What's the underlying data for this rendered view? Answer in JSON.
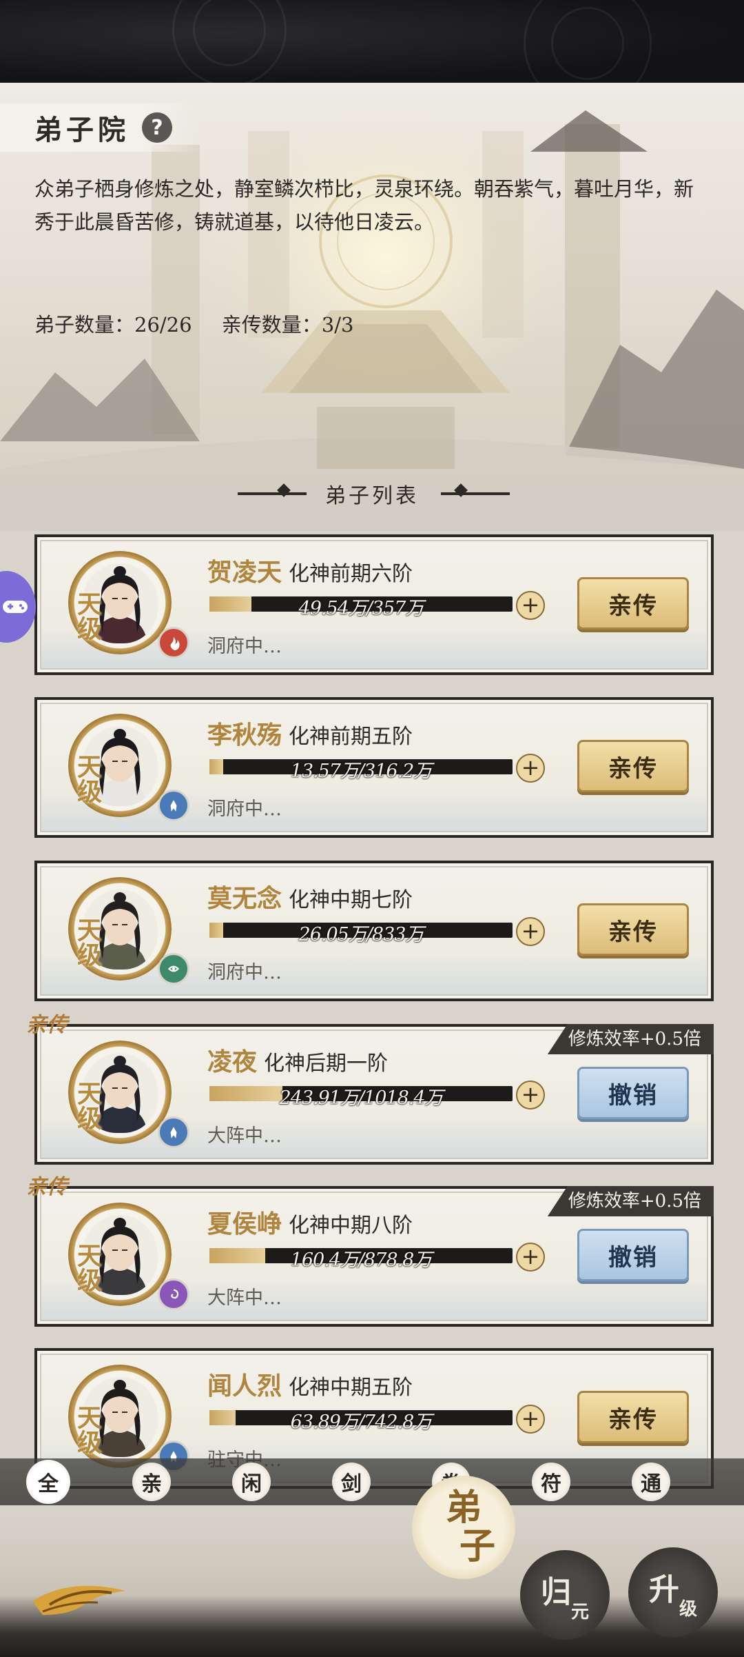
{
  "page": {
    "title": "弟子院",
    "intro": "众弟子栖身修炼之处，静室鳞次栉比，灵泉环绕。朝吞紫气，暮吐月华，新秀于此晨昏苦修，铸就道基，以待他日凌云。",
    "disciple_count": "弟子数量：26/26",
    "apprentice_count": "亲传数量：3/3",
    "list_title": "弟子列表"
  },
  "disciples": [
    {
      "name": "贺凌天",
      "realm": "化神前期六阶",
      "exp": "49.54万/357万",
      "progress": 0.139,
      "status": "洞府中…",
      "rank": "天级",
      "element_icon": "fire-icon",
      "element_color": "#c9483a",
      "action": "亲传",
      "action_style": "gold",
      "is_apprentice": false,
      "bonus": "",
      "hair": "#1c1a1d",
      "robe": "#4a2a30"
    },
    {
      "name": "李秋殇",
      "realm": "化神前期五阶",
      "exp": "13.57万/316.2万",
      "progress": 0.043,
      "status": "洞府中…",
      "rank": "天级",
      "element_icon": "water-icon",
      "element_color": "#4b7ab8",
      "action": "亲传",
      "action_style": "gold",
      "is_apprentice": false,
      "bonus": "",
      "hair": "#1a1a1e",
      "robe": "#e8e6e2"
    },
    {
      "name": "莫无念",
      "realm": "化神中期七阶",
      "exp": "26.05万/833万",
      "progress": 0.031,
      "status": "洞府中…",
      "rank": "天级",
      "element_icon": "wind-icon",
      "element_color": "#3c8a6a",
      "action": "亲传",
      "action_style": "gold",
      "is_apprentice": false,
      "bonus": "",
      "hair": "#22201e",
      "robe": "#5a5e4a"
    },
    {
      "name": "凌夜",
      "realm": "化神后期一阶",
      "exp": "243.91万/1018.4万",
      "progress": 0.24,
      "status": "大阵中…",
      "rank": "天级",
      "element_icon": "water-icon",
      "element_color": "#4b7ab8",
      "action": "撤销",
      "action_style": "blue",
      "is_apprentice": true,
      "apprentice_label": "亲传",
      "bonus": "修炼效率+0.5倍",
      "hair": "#222027",
      "robe": "#2a2e3a"
    },
    {
      "name": "夏侯峥",
      "realm": "化神中期八阶",
      "exp": "160.4万/878.8万",
      "progress": 0.183,
      "status": "大阵中…",
      "rank": "天级",
      "element_icon": "vortex-icon",
      "element_color": "#8a57b8",
      "action": "撤销",
      "action_style": "blue",
      "is_apprentice": true,
      "apprentice_label": "亲传",
      "bonus": "修炼效率+0.5倍",
      "hair": "#1c1b1c",
      "robe": "#3a3a3c"
    },
    {
      "name": "闻人烈",
      "realm": "化神中期五阶",
      "exp": "63.89万/742.8万",
      "progress": 0.086,
      "status": "驻守中…",
      "rank": "天级",
      "element_icon": "water-icon",
      "element_color": "#4b7ab8",
      "action": "亲传",
      "action_style": "gold",
      "is_apprentice": false,
      "bonus": "",
      "hair": "#1e1c1a",
      "robe": "#4a4036"
    }
  ],
  "filters": [
    {
      "label": "全",
      "active": true
    },
    {
      "label": "亲",
      "active": false
    },
    {
      "label": "闲",
      "active": false
    },
    {
      "label": "剑",
      "active": false
    },
    {
      "label": "拳",
      "active": false
    },
    {
      "label": "符",
      "active": false
    },
    {
      "label": "通",
      "active": false
    }
  ],
  "nav": {
    "disciple_top": "弟",
    "disciple_bottom": "子",
    "guiyuan_top": "归",
    "guiyuan_bottom": "元",
    "upgrade_top": "升",
    "upgrade_bottom": "级"
  }
}
